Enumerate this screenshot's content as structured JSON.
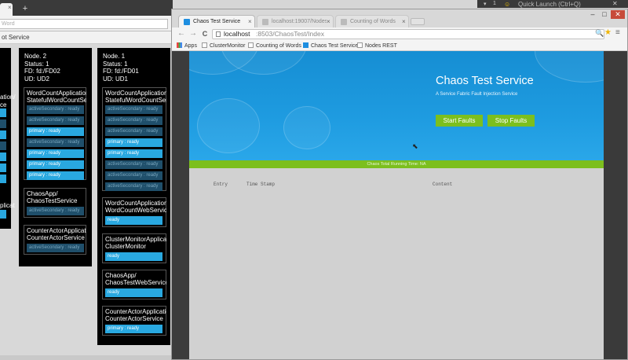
{
  "background_window": {
    "tab_new_glyph": "+",
    "url_placeholder": "Word",
    "bookmark_label": "ot Service",
    "node2": {
      "info": [
        "Node. 2",
        "Status: 1",
        "FD: fd:/FD02",
        "UD: UD2"
      ],
      "services": [
        {
          "title1": "WordCountApplication/",
          "title2": "StatefulWordCountService",
          "bars": [
            {
              "text": "activeSecondary : ready",
              "kind": "sec"
            },
            {
              "text": "activeSecondary : ready",
              "kind": "sec"
            },
            {
              "text": "primary : ready",
              "kind": "ready"
            },
            {
              "text": "activeSecondary : ready",
              "kind": "sec"
            },
            {
              "text": "primary : ready",
              "kind": "ready"
            },
            {
              "text": "primary : ready",
              "kind": "ready"
            },
            {
              "text": "primary : ready",
              "kind": "ready"
            }
          ]
        },
        {
          "title1": "ChaosApp/",
          "title2": "ChaosTestService",
          "bars": [
            {
              "text": "activeSecondary : ready",
              "kind": "sec"
            }
          ]
        },
        {
          "title1": "CounterActorApplication/",
          "title2": "CounterActorService",
          "bars": [
            {
              "text": "activeSecondary : ready",
              "kind": "sec"
            }
          ]
        }
      ]
    },
    "node1": {
      "info": [
        "Node. 1",
        "Status: 1",
        "FD: fd:/FD01",
        "UD: UD1"
      ],
      "services": [
        {
          "title1": "WordCountApplication/",
          "title2": "StatefulWordCountService",
          "bars": [
            {
              "text": "activeSecondary : ready",
              "kind": "sec"
            },
            {
              "text": "activeSecondary : ready",
              "kind": "sec"
            },
            {
              "text": "activeSecondary : ready",
              "kind": "sec"
            },
            {
              "text": "primary : ready",
              "kind": "ready"
            },
            {
              "text": "primary : ready",
              "kind": "ready"
            },
            {
              "text": "activeSecondary : ready",
              "kind": "sec"
            },
            {
              "text": "activeSecondary : ready",
              "kind": "sec"
            },
            {
              "text": "activeSecondary : ready",
              "kind": "sec"
            }
          ]
        },
        {
          "title1": "WordCountApplication/",
          "title2": "WordCountWebService",
          "bars": [
            {
              "text": "ready",
              "kind": "ready"
            }
          ]
        },
        {
          "title1": "ClusterMonitorApplication/",
          "title2": "ClusterMonitor",
          "bars": [
            {
              "text": "ready",
              "kind": "ready"
            }
          ]
        },
        {
          "title1": "ChaosApp/",
          "title2": "ChaosTestWebService",
          "bars": [
            {
              "text": "ready",
              "kind": "ready"
            }
          ]
        },
        {
          "title1": "CounterActorApplication/",
          "title2": "CounterActorService",
          "bars": [
            {
              "text": "primary : ready",
              "kind": "ready"
            }
          ]
        }
      ]
    },
    "partial_left": {
      "title1": "ation/",
      "title2": "plicat",
      "title3": "ce"
    }
  },
  "taskbar": {
    "flag_icon": "▾",
    "notification_count": "1",
    "smile_icon": "☺",
    "quick_launch": "Quick Launch (Ctrl+Q)",
    "close_glyph": "✕"
  },
  "browser": {
    "tabs": [
      {
        "label": "Chaos Test Service",
        "active": true
      },
      {
        "label": "localhost:19007/Nodes/Sc",
        "active": false
      },
      {
        "label": "Counting of Words",
        "active": false
      }
    ],
    "tab_close_glyph": "×",
    "window_controls": {
      "minimize": "–",
      "maximize": "□",
      "close": "✕"
    },
    "nav": {
      "back": "←",
      "forward": "→",
      "reload": "C"
    },
    "url_host": "localhost",
    "url_path": ":8503/ChaosTest/Index",
    "toolbar_icons": {
      "zoom": "🔍",
      "star": "★",
      "menu": "≡"
    },
    "bookmarks": [
      "Apps",
      "ClusterMonitor",
      "Counting of Words",
      "Chaos Test Service",
      "Nodes REST"
    ]
  },
  "page": {
    "title": "Chaos Test Service",
    "subtitle": "A Service Fabric Fault Injection Service",
    "start_button": "Start Faults",
    "stop_button": "Stop Faults",
    "running_time": "Chaos Total Running Time: NA",
    "columns": [
      "Entry",
      "Time Stamp",
      "Content"
    ],
    "cursor_glyph": "⬉"
  },
  "colors": {
    "hero_blue": "#1e9be0",
    "accent_green": "#7cbf1e",
    "ready_blue": "#29a8e0",
    "secondary_bar": "#1f4f6b"
  }
}
